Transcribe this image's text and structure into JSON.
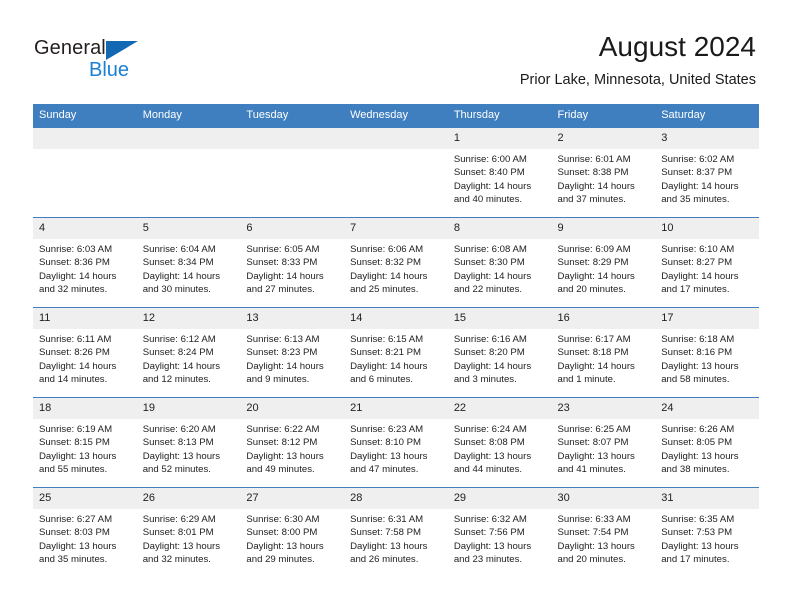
{
  "brand": {
    "name_part1": "General",
    "name_part2": "Blue",
    "triangle_color": "#1268b3",
    "blue_color": "#1b7fd4"
  },
  "header": {
    "title": "August 2024",
    "subtitle": "Prior Lake, Minnesota, United States"
  },
  "theme": {
    "header_bar": "#3f7fbf",
    "day_band": "#efefef",
    "text": "#222222"
  },
  "columns": [
    "Sunday",
    "Monday",
    "Tuesday",
    "Wednesday",
    "Thursday",
    "Friday",
    "Saturday"
  ],
  "weeks": [
    [
      {
        "day": "",
        "empty": true
      },
      {
        "day": "",
        "empty": true
      },
      {
        "day": "",
        "empty": true
      },
      {
        "day": "",
        "empty": true
      },
      {
        "day": "1",
        "sunrise": "Sunrise: 6:00 AM",
        "sunset": "Sunset: 8:40 PM",
        "daylight": "Daylight: 14 hours and 40 minutes."
      },
      {
        "day": "2",
        "sunrise": "Sunrise: 6:01 AM",
        "sunset": "Sunset: 8:38 PM",
        "daylight": "Daylight: 14 hours and 37 minutes."
      },
      {
        "day": "3",
        "sunrise": "Sunrise: 6:02 AM",
        "sunset": "Sunset: 8:37 PM",
        "daylight": "Daylight: 14 hours and 35 minutes."
      }
    ],
    [
      {
        "day": "4",
        "sunrise": "Sunrise: 6:03 AM",
        "sunset": "Sunset: 8:36 PM",
        "daylight": "Daylight: 14 hours and 32 minutes."
      },
      {
        "day": "5",
        "sunrise": "Sunrise: 6:04 AM",
        "sunset": "Sunset: 8:34 PM",
        "daylight": "Daylight: 14 hours and 30 minutes."
      },
      {
        "day": "6",
        "sunrise": "Sunrise: 6:05 AM",
        "sunset": "Sunset: 8:33 PM",
        "daylight": "Daylight: 14 hours and 27 minutes."
      },
      {
        "day": "7",
        "sunrise": "Sunrise: 6:06 AM",
        "sunset": "Sunset: 8:32 PM",
        "daylight": "Daylight: 14 hours and 25 minutes."
      },
      {
        "day": "8",
        "sunrise": "Sunrise: 6:08 AM",
        "sunset": "Sunset: 8:30 PM",
        "daylight": "Daylight: 14 hours and 22 minutes."
      },
      {
        "day": "9",
        "sunrise": "Sunrise: 6:09 AM",
        "sunset": "Sunset: 8:29 PM",
        "daylight": "Daylight: 14 hours and 20 minutes."
      },
      {
        "day": "10",
        "sunrise": "Sunrise: 6:10 AM",
        "sunset": "Sunset: 8:27 PM",
        "daylight": "Daylight: 14 hours and 17 minutes."
      }
    ],
    [
      {
        "day": "11",
        "sunrise": "Sunrise: 6:11 AM",
        "sunset": "Sunset: 8:26 PM",
        "daylight": "Daylight: 14 hours and 14 minutes."
      },
      {
        "day": "12",
        "sunrise": "Sunrise: 6:12 AM",
        "sunset": "Sunset: 8:24 PM",
        "daylight": "Daylight: 14 hours and 12 minutes."
      },
      {
        "day": "13",
        "sunrise": "Sunrise: 6:13 AM",
        "sunset": "Sunset: 8:23 PM",
        "daylight": "Daylight: 14 hours and 9 minutes."
      },
      {
        "day": "14",
        "sunrise": "Sunrise: 6:15 AM",
        "sunset": "Sunset: 8:21 PM",
        "daylight": "Daylight: 14 hours and 6 minutes."
      },
      {
        "day": "15",
        "sunrise": "Sunrise: 6:16 AM",
        "sunset": "Sunset: 8:20 PM",
        "daylight": "Daylight: 14 hours and 3 minutes."
      },
      {
        "day": "16",
        "sunrise": "Sunrise: 6:17 AM",
        "sunset": "Sunset: 8:18 PM",
        "daylight": "Daylight: 14 hours and 1 minute."
      },
      {
        "day": "17",
        "sunrise": "Sunrise: 6:18 AM",
        "sunset": "Sunset: 8:16 PM",
        "daylight": "Daylight: 13 hours and 58 minutes."
      }
    ],
    [
      {
        "day": "18",
        "sunrise": "Sunrise: 6:19 AM",
        "sunset": "Sunset: 8:15 PM",
        "daylight": "Daylight: 13 hours and 55 minutes."
      },
      {
        "day": "19",
        "sunrise": "Sunrise: 6:20 AM",
        "sunset": "Sunset: 8:13 PM",
        "daylight": "Daylight: 13 hours and 52 minutes."
      },
      {
        "day": "20",
        "sunrise": "Sunrise: 6:22 AM",
        "sunset": "Sunset: 8:12 PM",
        "daylight": "Daylight: 13 hours and 49 minutes."
      },
      {
        "day": "21",
        "sunrise": "Sunrise: 6:23 AM",
        "sunset": "Sunset: 8:10 PM",
        "daylight": "Daylight: 13 hours and 47 minutes."
      },
      {
        "day": "22",
        "sunrise": "Sunrise: 6:24 AM",
        "sunset": "Sunset: 8:08 PM",
        "daylight": "Daylight: 13 hours and 44 minutes."
      },
      {
        "day": "23",
        "sunrise": "Sunrise: 6:25 AM",
        "sunset": "Sunset: 8:07 PM",
        "daylight": "Daylight: 13 hours and 41 minutes."
      },
      {
        "day": "24",
        "sunrise": "Sunrise: 6:26 AM",
        "sunset": "Sunset: 8:05 PM",
        "daylight": "Daylight: 13 hours and 38 minutes."
      }
    ],
    [
      {
        "day": "25",
        "sunrise": "Sunrise: 6:27 AM",
        "sunset": "Sunset: 8:03 PM",
        "daylight": "Daylight: 13 hours and 35 minutes."
      },
      {
        "day": "26",
        "sunrise": "Sunrise: 6:29 AM",
        "sunset": "Sunset: 8:01 PM",
        "daylight": "Daylight: 13 hours and 32 minutes."
      },
      {
        "day": "27",
        "sunrise": "Sunrise: 6:30 AM",
        "sunset": "Sunset: 8:00 PM",
        "daylight": "Daylight: 13 hours and 29 minutes."
      },
      {
        "day": "28",
        "sunrise": "Sunrise: 6:31 AM",
        "sunset": "Sunset: 7:58 PM",
        "daylight": "Daylight: 13 hours and 26 minutes."
      },
      {
        "day": "29",
        "sunrise": "Sunrise: 6:32 AM",
        "sunset": "Sunset: 7:56 PM",
        "daylight": "Daylight: 13 hours and 23 minutes."
      },
      {
        "day": "30",
        "sunrise": "Sunrise: 6:33 AM",
        "sunset": "Sunset: 7:54 PM",
        "daylight": "Daylight: 13 hours and 20 minutes."
      },
      {
        "day": "31",
        "sunrise": "Sunrise: 6:35 AM",
        "sunset": "Sunset: 7:53 PM",
        "daylight": "Daylight: 13 hours and 17 minutes."
      }
    ]
  ]
}
